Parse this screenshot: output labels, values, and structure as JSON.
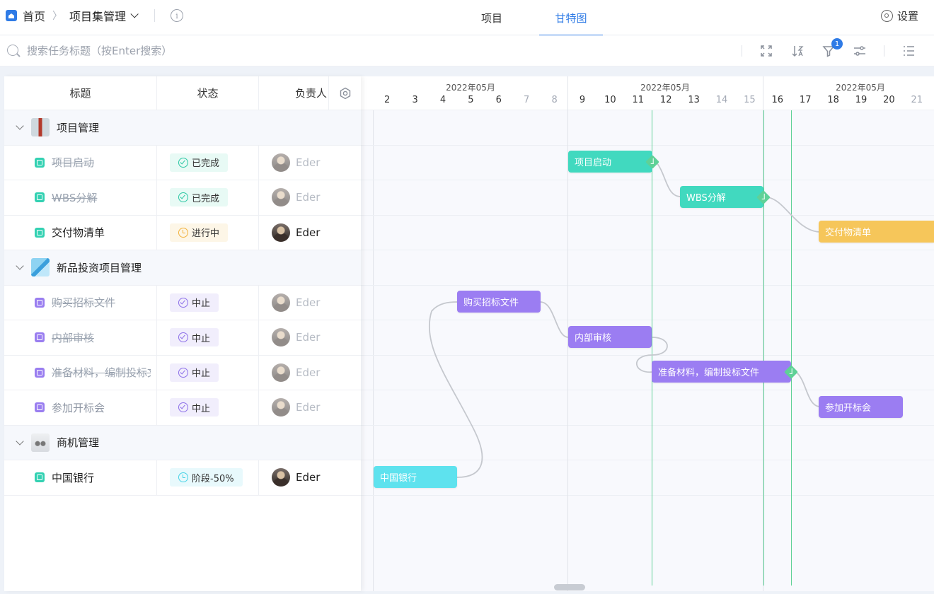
{
  "breadcrumb": {
    "home": "首页",
    "current": "项目集管理"
  },
  "tabs": [
    {
      "label": "项目"
    },
    {
      "label": "甘特图"
    }
  ],
  "settings_label": "设置",
  "search": {
    "placeholder": "搜索任务标题（按Enter搜索）"
  },
  "filter_badge": "1",
  "table": {
    "headers": {
      "title": "标题",
      "status": "状态",
      "owner": "负责人"
    },
    "groups": [
      {
        "title": "项目管理",
        "tasks": [
          {
            "title": "项目启动",
            "status": "已完成",
            "owner": "Eder"
          },
          {
            "title": "WBS分解",
            "status": "已完成",
            "owner": "Eder"
          },
          {
            "title": "交付物清单",
            "status": "进行中",
            "owner": "Eder"
          }
        ]
      },
      {
        "title": "新品投资项目管理",
        "tasks": [
          {
            "title": "购买招标文件",
            "status": "中止",
            "owner": "Eder"
          },
          {
            "title": "内部审核",
            "status": "中止",
            "owner": "Eder"
          },
          {
            "title": "准备材料，编制投标文件",
            "status": "中止",
            "owner": "Eder"
          },
          {
            "title": "参加开标会",
            "status": "中止",
            "owner": "Eder"
          }
        ]
      },
      {
        "title": "商机管理",
        "tasks": [
          {
            "title": "中国银行",
            "status": "阶段-50%",
            "owner": "Eder"
          }
        ]
      }
    ]
  },
  "gantt": {
    "weeks": [
      {
        "label": "2022年05月"
      },
      {
        "label": "2022年05月"
      },
      {
        "label": "2022年05月"
      }
    ],
    "days": [
      "2",
      "3",
      "4",
      "5",
      "6",
      "7",
      "8",
      "9",
      "10",
      "11",
      "12",
      "13",
      "14",
      "15",
      "16",
      "17",
      "18",
      "19",
      "20",
      "21"
    ],
    "bars": [
      {
        "label": "项目启动"
      },
      {
        "label": "WBS分解"
      },
      {
        "label": "交付物清单"
      },
      {
        "label": "购买招标文件"
      },
      {
        "label": "内部审核"
      },
      {
        "label": "准备材料，编制投标文件"
      },
      {
        "label": "参加开标会"
      },
      {
        "label": "中国银行"
      }
    ]
  },
  "colors": {
    "accent": "#2f7be6",
    "teal": "#41d9bf",
    "yellow": "#f6c65a",
    "purple": "#9b7df2",
    "cyan": "#5ee2ee",
    "milestone": "#5fd197"
  }
}
